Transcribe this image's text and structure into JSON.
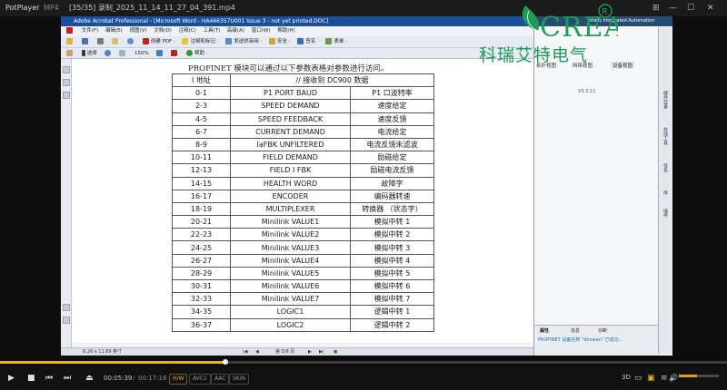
{
  "player": {
    "app_name": "PotPlayer",
    "format": "MP4",
    "file_title": "[35/35] 录制_2025_11_14_11_27_04_391.mp4",
    "accent": "#e8b31a",
    "progress": 0.31,
    "volume": 0.45,
    "time_current": "00:05:39",
    "time_total": "00:17:18",
    "badges": [
      "H/W",
      "AVC1",
      "AAC",
      "SKIN"
    ],
    "right_icons": [
      "3D",
      "speaker-icon"
    ]
  },
  "acrobat": {
    "title": "Adobe Acrobat Professional - [Microsoft Word - HA466357U001 Issue 3 - not yet printed.DOC]",
    "menu": [
      "文件(F)",
      "编辑(E)",
      "视图(V)",
      "文档(D)",
      "注释(C)",
      "工具(T)",
      "高级(A)",
      "窗口(W)",
      "帮助(H)"
    ],
    "toolbar1": [
      "创建 PDF ·",
      "注释和标记 ·",
      "发送供审阅 ·",
      "安全 ·",
      "签名 ·",
      "表单 ·"
    ],
    "toolbar2": [
      "选择",
      "150%",
      "帮助 ·"
    ],
    "page_size": "8.26 x 11.69 英寸",
    "page_indicator": "第 5/8 页"
  },
  "document": {
    "intro": "PROFINET 模块可以通过以下参数表格对参数进行访问。",
    "header": {
      "col1": "I 地址",
      "col2": "// 接收到 DC900 数据"
    },
    "rows": [
      [
        "0-1",
        "P1 PORT BAUD",
        "P1 口波特率"
      ],
      [
        "2-3",
        "SPEED DEMAND",
        "速度给定"
      ],
      [
        "4-5",
        "SPEED FEEDBACK",
        "速度反馈"
      ],
      [
        "6-7",
        "CURRENT DEMAND",
        "电流给定"
      ],
      [
        "8-9",
        "IaFBK UNFILTERED",
        "电流反馈未滤波"
      ],
      [
        "10-11",
        "FIELD DEMAND",
        "励磁给定"
      ],
      [
        "12-13",
        "FIELD I FBK",
        "励磁电流反馈"
      ],
      [
        "14-15",
        "HEALTH WORD",
        "故障字"
      ],
      [
        "16-17",
        "ENCODER",
        "编码器转速"
      ],
      [
        "18-19",
        "MULTIPLEXER",
        "转换器 （状态字）"
      ],
      [
        "20-21",
        "Minilink VALUE1",
        "模拟中转 1"
      ],
      [
        "22-23",
        "Minilink VALUE2",
        "模拟中转 2"
      ],
      [
        "24-25",
        "Minilink VALUE3",
        "模拟中转 3"
      ],
      [
        "26-27",
        "Minilink VALUE4",
        "模拟中转 4"
      ],
      [
        "28-29",
        "Minilink VALUE5",
        "模拟中转 5"
      ],
      [
        "30-31",
        "Minilink VALUE6",
        "模拟中转 6"
      ],
      [
        "32-33",
        "Minilink VALUE7",
        "模拟中转 7"
      ],
      [
        "34-35",
        "LOGIC1",
        "逻辑中转 1"
      ],
      [
        "36-37",
        "LOGIC2",
        "逻辑中转 2"
      ]
    ]
  },
  "tia": {
    "title_hint": "Totally Integrated Automation",
    "tabs": [
      "拓扑视图",
      "网络视图",
      "设备视图"
    ],
    "version": "V3.3.11",
    "bottom_tabs": [
      "属性",
      "信息",
      "诊断"
    ],
    "status": "PROFINET 设备名称 \"dhvwan\" 已成功...",
    "side_labels": [
      "硬件目录",
      "在线工具",
      "任务",
      "库",
      "插件"
    ]
  },
  "brand": {
    "latin": "CREATE",
    "cn": "科瑞艾特电气",
    "color": "#1f9b58"
  }
}
